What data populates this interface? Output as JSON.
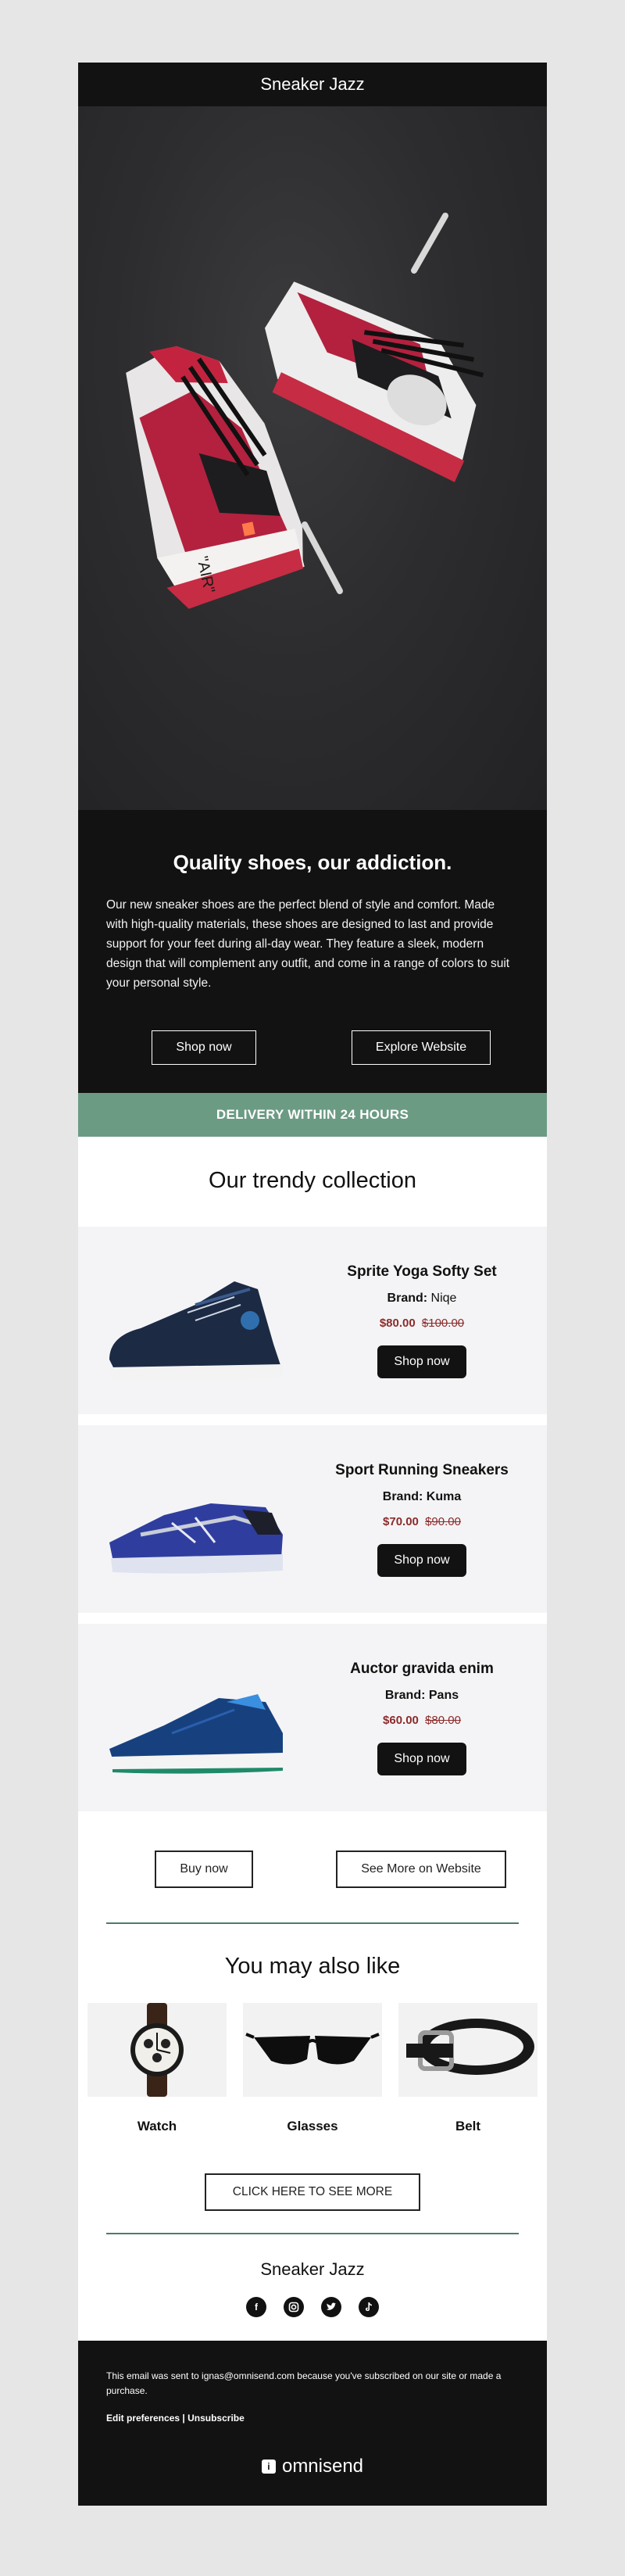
{
  "header": {
    "store_name": "Sneaker Jazz"
  },
  "hero": {
    "image_alt": "Red and white high-top sneakers"
  },
  "intro": {
    "title": "Quality shoes, our addiction.",
    "body": "Our new sneaker shoes are the perfect blend of style and comfort. Made with high-quality materials, these shoes are designed to last and provide support for your feet during all-day wear. They feature a sleek, modern design that will complement any outfit, and come in a range of colors to suit your personal style.",
    "primary_button": "Shop now",
    "secondary_button": "Explore Website"
  },
  "delivery_banner": "DELIVERY WITHIN 24 HOURS",
  "collection": {
    "title": "Our trendy collection",
    "products": [
      {
        "name": "Sprite Yoga Softy Set",
        "brand_label": "Brand:",
        "brand": "Niqe",
        "price": "$80.00",
        "old_price": "$100.00",
        "button": "Shop now"
      },
      {
        "name": "Sport Running Sneakers",
        "brand_label": "Brand:",
        "brand": "Kuma",
        "price": "$70.00",
        "old_price": "$90.00",
        "button": "Shop now"
      },
      {
        "name": "Auctor gravida enim",
        "brand_label": "Brand:",
        "brand": "Pans",
        "price": "$60.00",
        "old_price": "$80.00",
        "button": "Shop now"
      }
    ],
    "buy_button": "Buy now",
    "see_more_button": "See More on Website"
  },
  "also_like": {
    "title": "You may also like",
    "items": [
      {
        "label": "Watch"
      },
      {
        "label": "Glasses"
      },
      {
        "label": "Belt"
      }
    ],
    "cta": "CLICK HERE TO SEE MORE"
  },
  "signoff": {
    "store_name": "Sneaker Jazz",
    "social": [
      "facebook-icon",
      "instagram-icon",
      "twitter-icon",
      "tiktok-icon"
    ]
  },
  "footer": {
    "notice": "This email was sent to ignas@omnisend.com because you've subscribed on our site or made a purchase.",
    "edit_preferences": "Edit preferences",
    "separator": "|",
    "unsubscribe": "Unsubscribe",
    "brand": "omnisend"
  },
  "colors": {
    "dark": "#121212",
    "accent_green": "#6c9b84",
    "price_red": "#8c2b2b",
    "product_bg": "#f4f4f6"
  }
}
